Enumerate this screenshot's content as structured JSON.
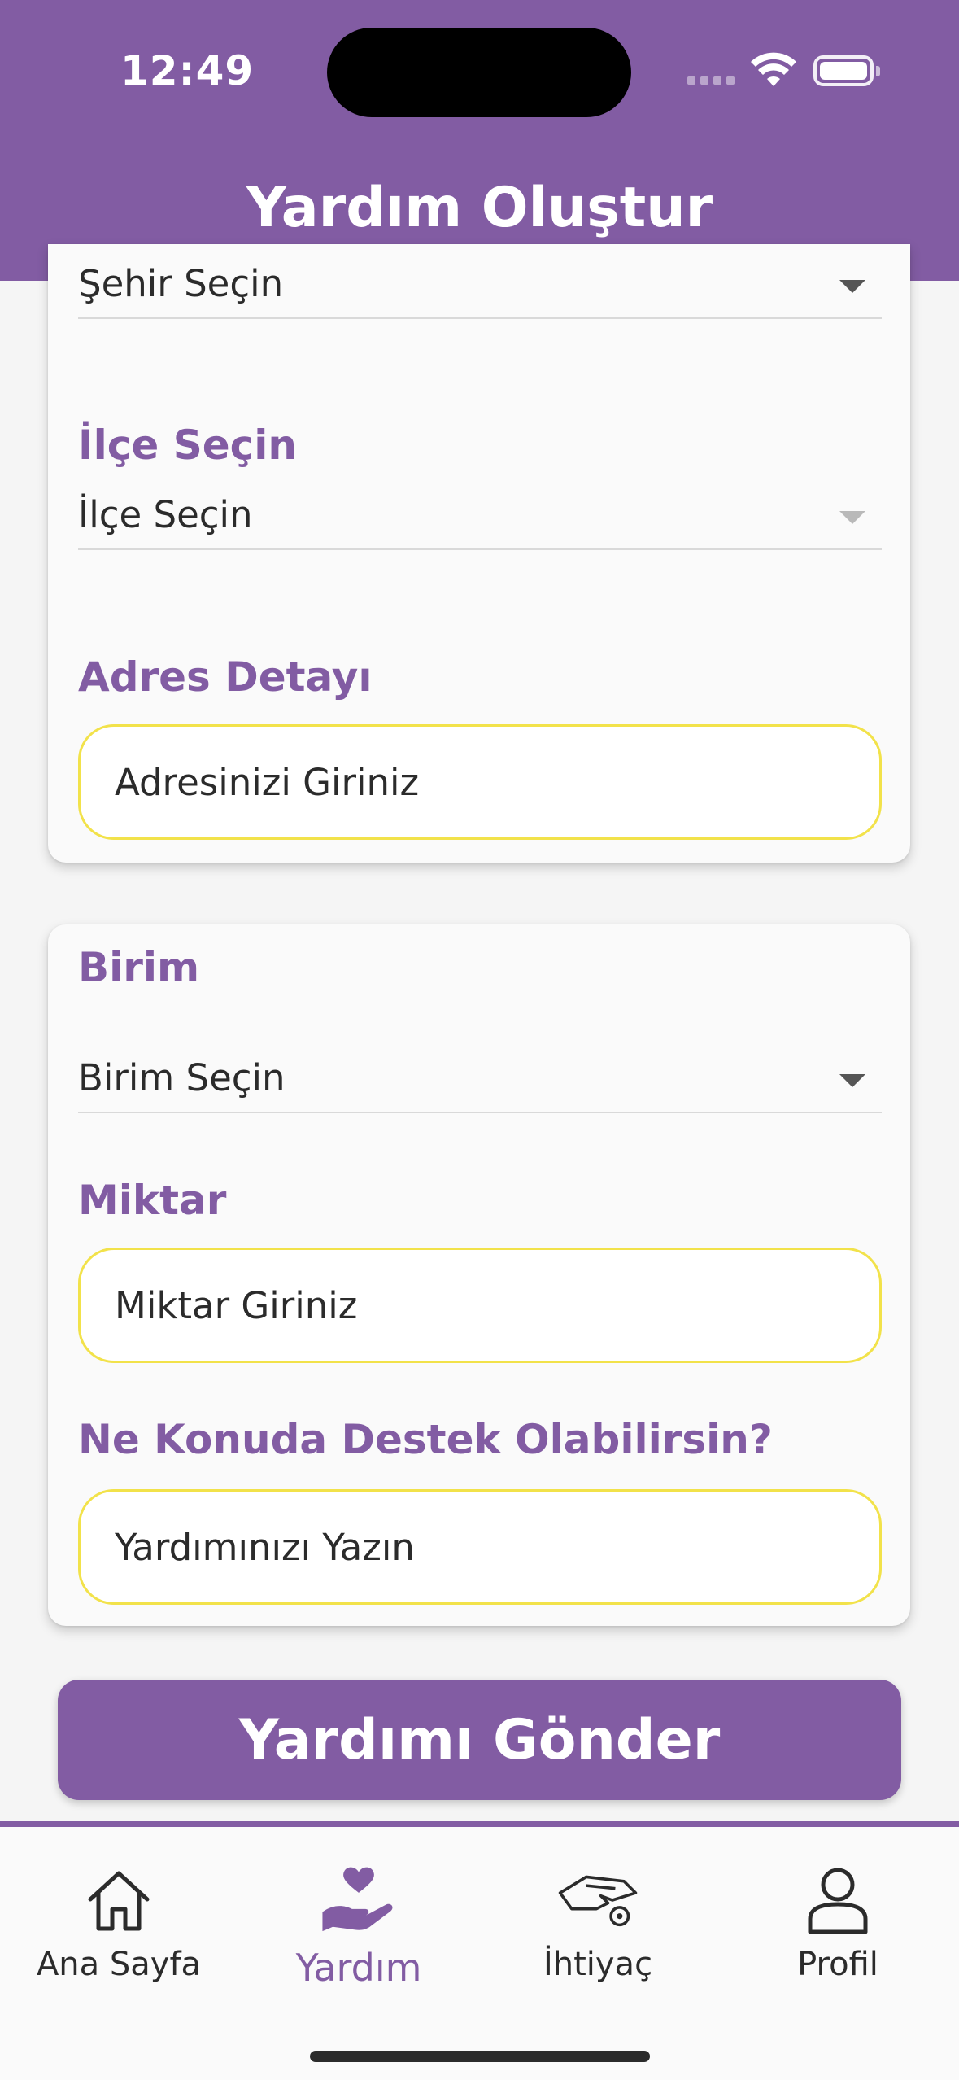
{
  "status_bar": {
    "time": "12:49"
  },
  "header": {
    "title": "Yardım Oluştur"
  },
  "address_card": {
    "city_dropdown": {
      "value": "Şehir Seçin"
    },
    "district": {
      "label": "İlçe Seçin",
      "value": "İlçe Seçin"
    },
    "address_detail": {
      "label": "Adres Detayı",
      "placeholder": "Adresinizi Giriniz"
    }
  },
  "details_card": {
    "unit": {
      "label": "Birim",
      "value": "Birim Seçin"
    },
    "amount": {
      "label": "Miktar",
      "placeholder": "Miktar Giriniz"
    },
    "support": {
      "label": "Ne Konuda Destek Olabilirsin?",
      "placeholder": "Yardımınızı Yazın"
    }
  },
  "submit_label": "Yardımı Gönder",
  "bottom_nav": {
    "items": [
      {
        "label": "Ana Sayfa",
        "icon": "home-icon"
      },
      {
        "label": "Yardım",
        "icon": "helping-hand-heart-icon"
      },
      {
        "label": "İhtiyaç",
        "icon": "hand-coin-icon"
      },
      {
        "label": "Profil",
        "icon": "user-icon"
      }
    ]
  },
  "colors": {
    "accent": "#825ca3",
    "field_border": "#f2e24a",
    "background": "#f5f5f5"
  }
}
